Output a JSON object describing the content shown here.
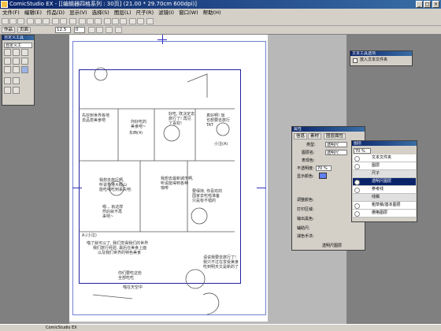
{
  "window": {
    "title": "ComicStudio EX - [[编辑器四格系列 : 30页] (21.00 * 29.70cm 600dpi)]",
    "minimize_icon": "minimize-icon",
    "maximize_icon": "maximize-icon",
    "close_icon": "close-icon"
  },
  "menu": [
    "文件(F)",
    "编辑(E)",
    "作品(D)",
    "显示(V)",
    "选择(S)",
    "图层(L)",
    "尺子(R)",
    "滤镜(I)",
    "窗口(W)",
    "帮助(H)"
  ],
  "toolbar": {
    "work_label": "作品",
    "page_tab": "页面",
    "zoom": "12.5",
    "angle": "0"
  },
  "tool_panel": {
    "title": "自定义工具",
    "preset": "自定义工",
    "icons": [
      "pen-icon",
      "pencil-icon",
      "marker-icon",
      "brush-icon",
      "eraser-icon",
      "dropper-icon",
      "fill-icon",
      "lasso-icon",
      "hand-icon",
      "zoom-icon",
      "star-icon",
      "move-icon",
      "ruler-icon"
    ]
  },
  "text_panel": {
    "title": "文本工具选项",
    "checkbox_label": "放入文本文件夹"
  },
  "property_panel": {
    "title": "属性",
    "tabs": [
      "信息",
      "素材",
      "图层属性"
    ],
    "type_label": "类型:",
    "type_value": "透明尺",
    "layer_name_label": "图层名:",
    "layer_name_value": "透明尺",
    "display_label": "表现色:",
    "opacity_label": "不透明度:",
    "opacity_value": "70 %",
    "display_color_label": "显示颜色:",
    "adjust_label": "调整颜色:",
    "print_label": "打印区域:",
    "output_label": "输出黑色:",
    "help_label": "辅助尺:",
    "reduce_label": "减色手法:",
    "lower_label": "显示",
    "nav_label": "透明尺图层"
  },
  "layer_panel": {
    "title": "图层",
    "opacity": "70 %",
    "layers": [
      {
        "name": "文本文件夹",
        "selected": false
      },
      {
        "name": "图层",
        "selected": false
      },
      {
        "name": "尺子",
        "selected": false
      },
      {
        "name": "透明尺图层",
        "selected": true
      },
      {
        "name": "参考线",
        "selected": false
      },
      {
        "name": "线稿",
        "selected": false
      },
      {
        "name": "粗草稿/基本图层",
        "selected": false
      },
      {
        "name": "栅格图层",
        "selected": false
      }
    ]
  },
  "sketch": {
    "bubble1": "先挖到世界各地\n去品尝美食吧",
    "bubble2": "你好吃的\n美食吧~",
    "bubble3": "好吃, 既决定去\n旅行了! 再见\n了喜欢!",
    "bubble4": "真好啊! 饭\n也想要去旅行\nTAT",
    "bubble5": "我想去旅行啊,\n听说香港大概山\n能吃喝吃到丢失吧.",
    "bubble6": "我想去最新城市啊,\n听说能得到各种\n咖啡",
    "bubble7": "嗯... 就这样\n然后就不再\n来吧~",
    "bubble8": "要保持, 你喜欢的\n国家去吃啦准备\n只是有不错的",
    "bubble9": "请说我要去旅行了!\n我只不过在享受美食\n吃到明天又是新的了",
    "bubble10": "你们要吃这些\n全部吃吃",
    "line1": "喵了就可以了, 我们觉得我们的世界",
    "line2": "我们旅行经验, 最后在美食上面",
    "line3": "以及我们世界的特色美食",
    "small1": "A.(小注)",
    "small2": "小注(A)",
    "small3": "东西(4)",
    "small4": "喵在天空中"
  },
  "status": {
    "text": "ComicStudio EX"
  }
}
